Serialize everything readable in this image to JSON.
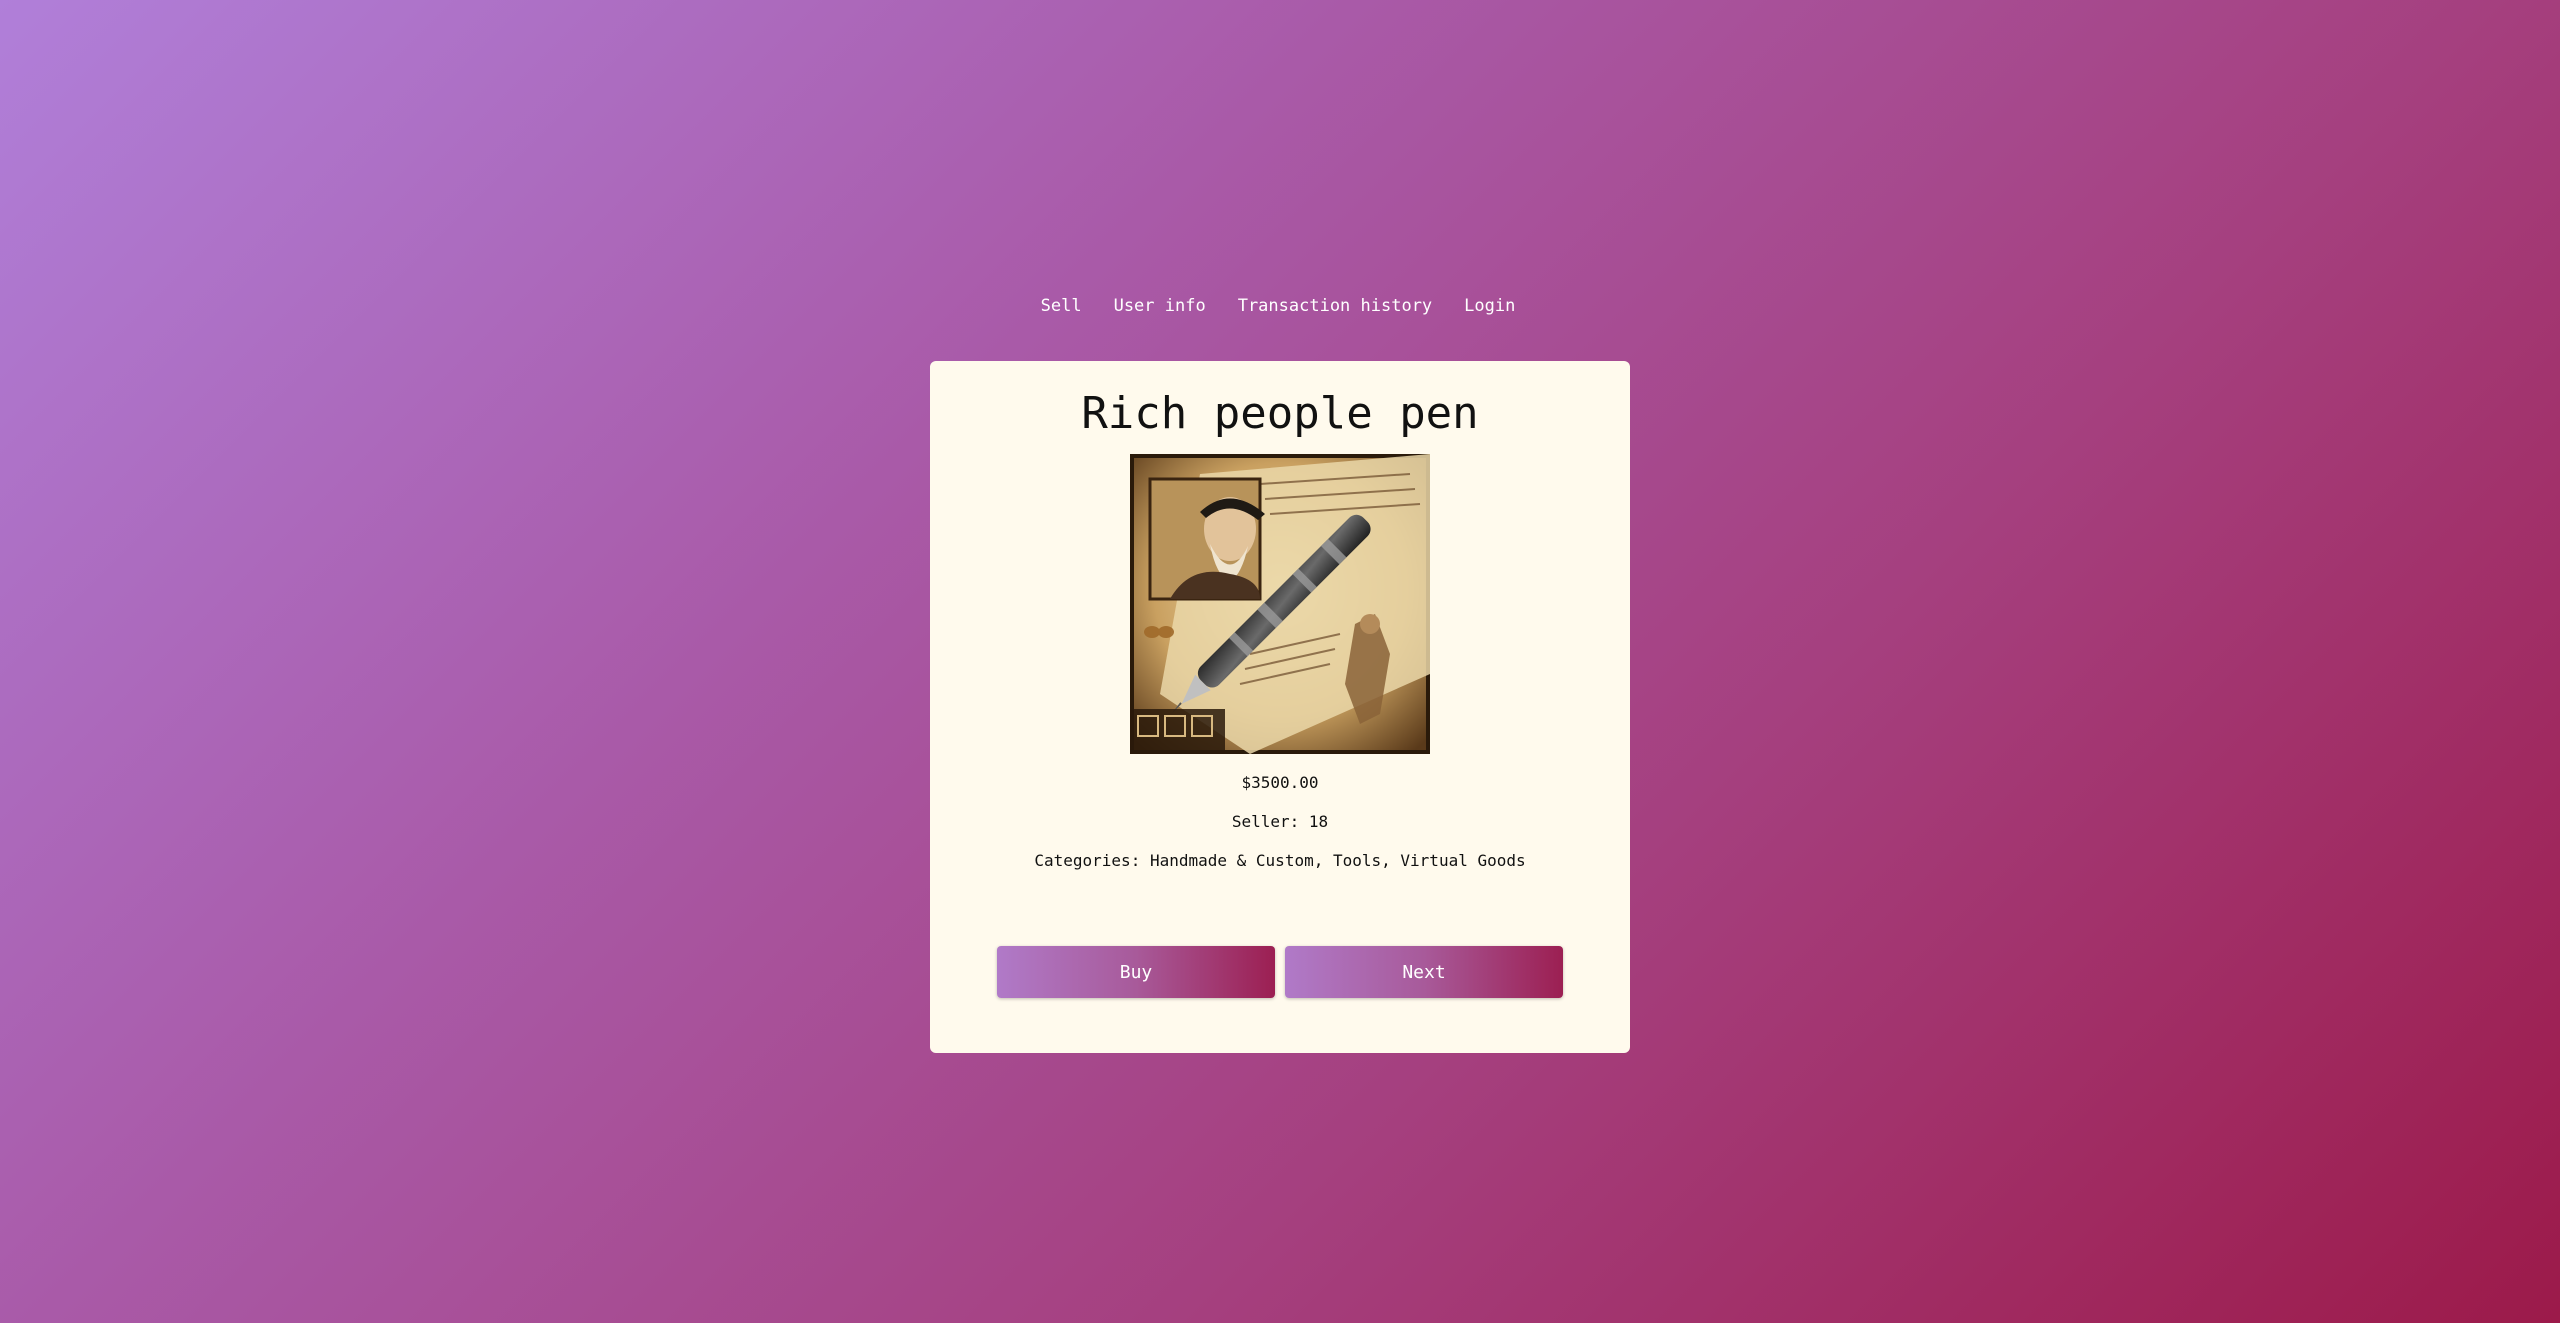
{
  "nav": {
    "items": [
      {
        "label": "Sell"
      },
      {
        "label": "User info"
      },
      {
        "label": "Transaction history"
      },
      {
        "label": "Login"
      }
    ]
  },
  "product": {
    "title": "Rich people pen",
    "image_icon": "product-image",
    "price": "$3500.00",
    "seller": "Seller: 18",
    "categories": "Categories: Handmade & Custom, Tools, Virtual Goods"
  },
  "actions": {
    "buy_label": "Buy",
    "next_label": "Next"
  },
  "colors": {
    "background_start": "#b07fd9",
    "background_end": "#9c1a4a",
    "card": "#fffaed",
    "button_start": "#b07ac8",
    "button_end": "#9c1f52"
  }
}
